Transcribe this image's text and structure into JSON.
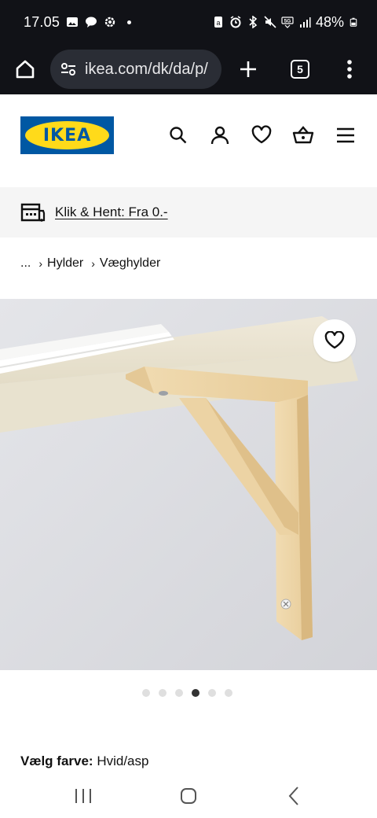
{
  "status_bar": {
    "time": "17.05",
    "battery": "48%"
  },
  "browser": {
    "url": "ikea.com/dk/da/p/",
    "tab_count": "5"
  },
  "header": {
    "logo_text": "IKEA",
    "icons": [
      "search-icon",
      "profile-icon",
      "heart-icon",
      "basket-icon",
      "hamburger-menu-icon"
    ]
  },
  "banner": {
    "text": "Klik & Hent: Fra 0.-"
  },
  "breadcrumb": {
    "ellipsis": "...",
    "items": [
      "Hylder",
      "Væghylder"
    ]
  },
  "carousel": {
    "count": 6,
    "active_index": 3
  },
  "product": {
    "color_label": "Vælg farve:",
    "color_value": "Hvid/asp"
  },
  "colors": {
    "dark_bar": "#111217",
    "ikea_blue": "#0058a3",
    "ikea_yellow": "#ffda1a"
  }
}
